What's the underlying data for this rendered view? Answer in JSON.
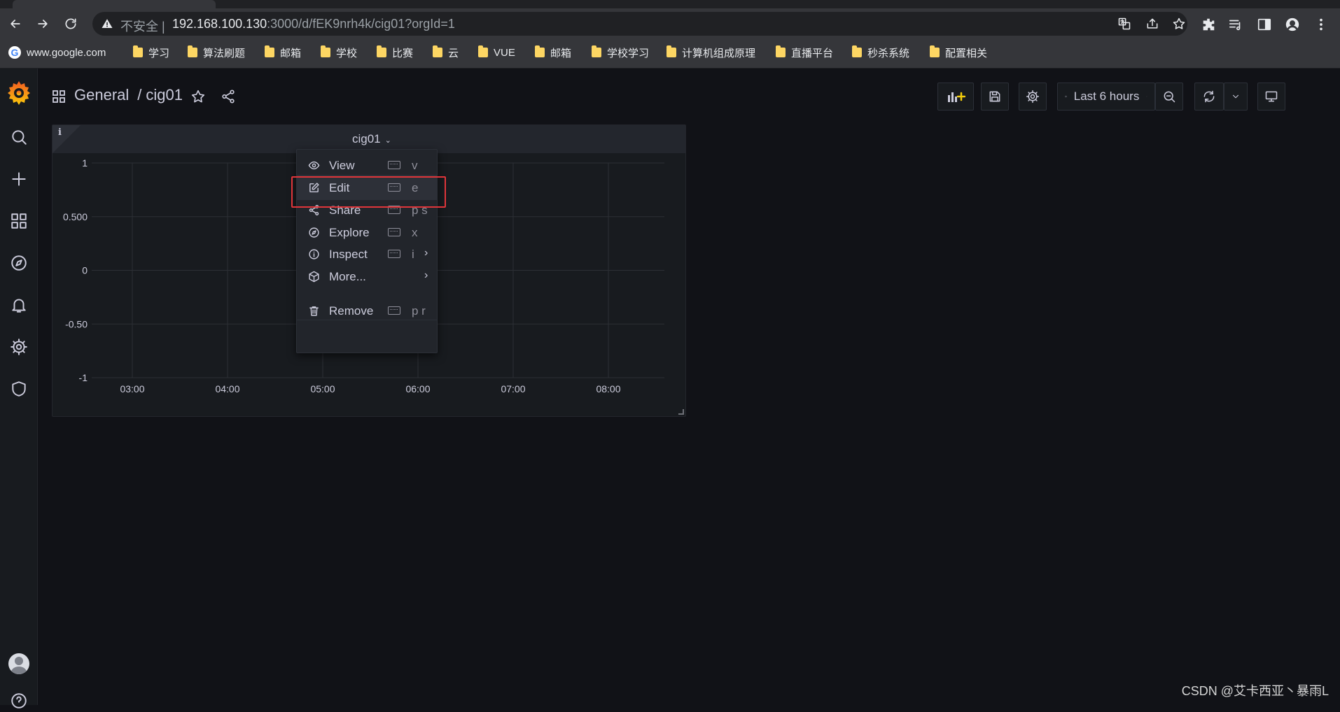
{
  "browser": {
    "security_label": "不安全",
    "security_separator": "|",
    "url_host": "192.168.100.130",
    "url_rest": ":3000/d/fEK9nrh4k/cig01?orgId=1",
    "bookmarks": [
      "www.google.com",
      "学习",
      "算法刷题",
      "邮箱",
      "学校",
      "比赛",
      "云",
      "VUE",
      "邮箱",
      "学校学习",
      "计算机组成原理",
      "直播平台",
      "秒杀系统",
      "配置相关"
    ]
  },
  "dashboard": {
    "folder": "General",
    "separator": "/",
    "title": "cig01",
    "time_range": "Last 6 hours"
  },
  "panel": {
    "title": "cig01",
    "info_badge": "i"
  },
  "chart_data": {
    "type": "line",
    "y_ticks": [
      "1",
      "0.500",
      "0",
      "-0.50",
      "-1"
    ],
    "x_ticks": [
      "03:00",
      "04:00",
      "05:00",
      "06:00",
      "07:00",
      "08:00"
    ],
    "ylim": [
      -1,
      1
    ],
    "series": [],
    "grid": true
  },
  "menu": {
    "items": [
      {
        "label": "View",
        "shortcut": "v",
        "icon": "eye-icon",
        "submenu": false
      },
      {
        "label": "Edit",
        "shortcut": "e",
        "icon": "edit-icon",
        "submenu": false
      },
      {
        "label": "Share",
        "shortcut": "p s",
        "icon": "share-icon",
        "submenu": false
      },
      {
        "label": "Explore",
        "shortcut": "x",
        "icon": "compass-icon",
        "submenu": false
      },
      {
        "label": "Inspect",
        "shortcut": "i",
        "icon": "info-circle-icon",
        "submenu": true
      },
      {
        "label": "More...",
        "shortcut": "",
        "icon": "cube-icon",
        "submenu": true
      },
      {
        "label": "Remove",
        "shortcut": "p r",
        "icon": "trash-icon",
        "submenu": false
      }
    ],
    "submenu_arrow": "›"
  },
  "watermark": "CSDN @艾卡西亚丶暴雨L",
  "colors": {
    "accent_highlight": "#e0353a",
    "bookmark_folder": "#fdd663",
    "grafana_orange": "#f46800"
  }
}
